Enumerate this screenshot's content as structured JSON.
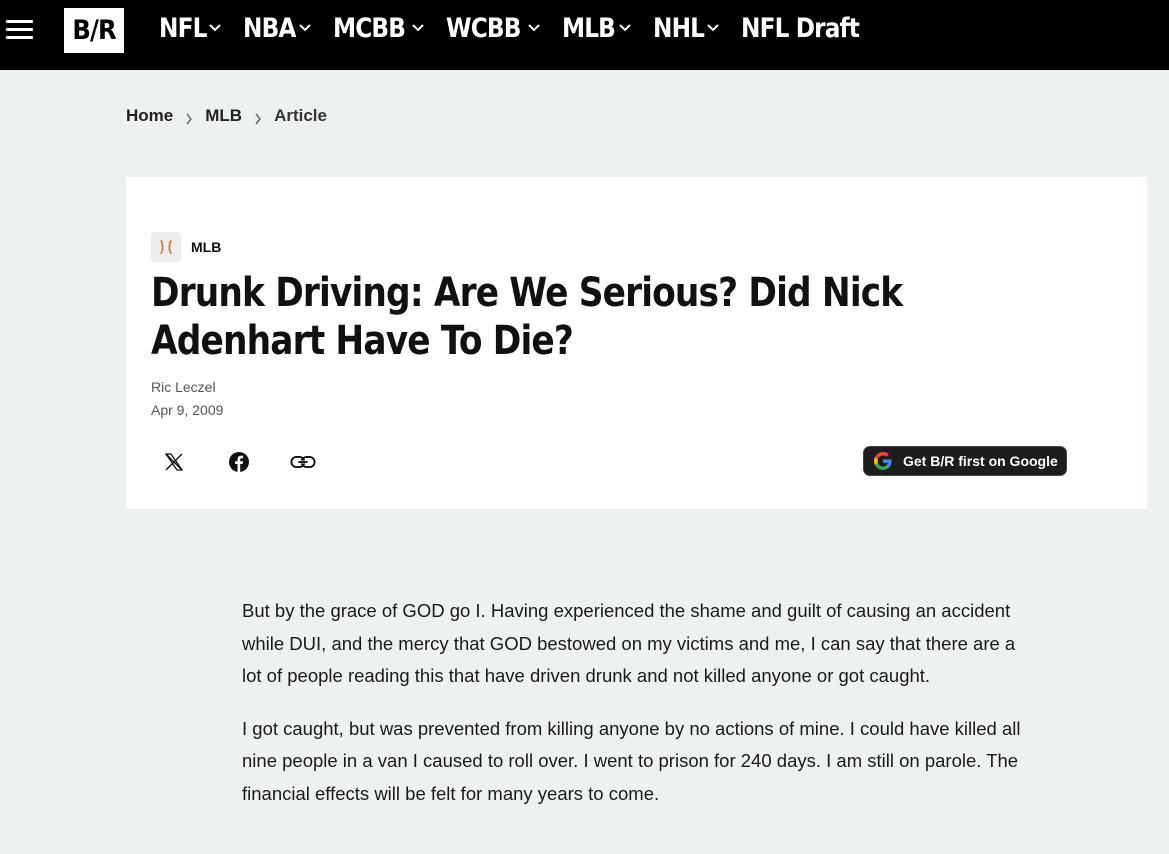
{
  "nav": {
    "logo_text": "B/R",
    "items": [
      {
        "label": "NFL",
        "has_dropdown": true
      },
      {
        "label": "NBA",
        "has_dropdown": true
      },
      {
        "label": "MCBB",
        "has_dropdown": true
      },
      {
        "label": "WCBB",
        "has_dropdown": true
      },
      {
        "label": "MLB",
        "has_dropdown": true
      },
      {
        "label": "NHL",
        "has_dropdown": true
      },
      {
        "label": "NFL Draft",
        "has_dropdown": false
      }
    ]
  },
  "breadcrumb": {
    "items": [
      "Home",
      "MLB",
      "Article"
    ]
  },
  "article": {
    "tag": "MLB",
    "tag_icon": "baseball-icon",
    "title": "Drunk Driving: Are We Serious? Did Nick Adenhart Have To Die?",
    "author": "Ric Leczel",
    "date": "Apr 9, 2009",
    "share_icons": [
      "x-icon",
      "facebook-icon",
      "link-icon"
    ],
    "google_button": "Get B/R first on Google",
    "paragraphs": [
      "But by the grace of GOD go I. Having experienced the shame and guilt of causing an accident while DUI, and the mercy that GOD bestowed on my victims and me, I can say that there are a lot of people reading this that have driven drunk and not killed anyone or got caught.",
      "I got caught, but was prevented from killing anyone by no actions of mine. I could have killed all nine people in a van I caused to roll over. I went to prison for 240 days. I am still on parole. The financial effects will be felt for many years to come."
    ]
  },
  "colors": {
    "topbar": "#000000",
    "page_bg": "#eef1f2",
    "card_bg": "#ffffff",
    "google_btn_bg": "#1d1d1d"
  }
}
